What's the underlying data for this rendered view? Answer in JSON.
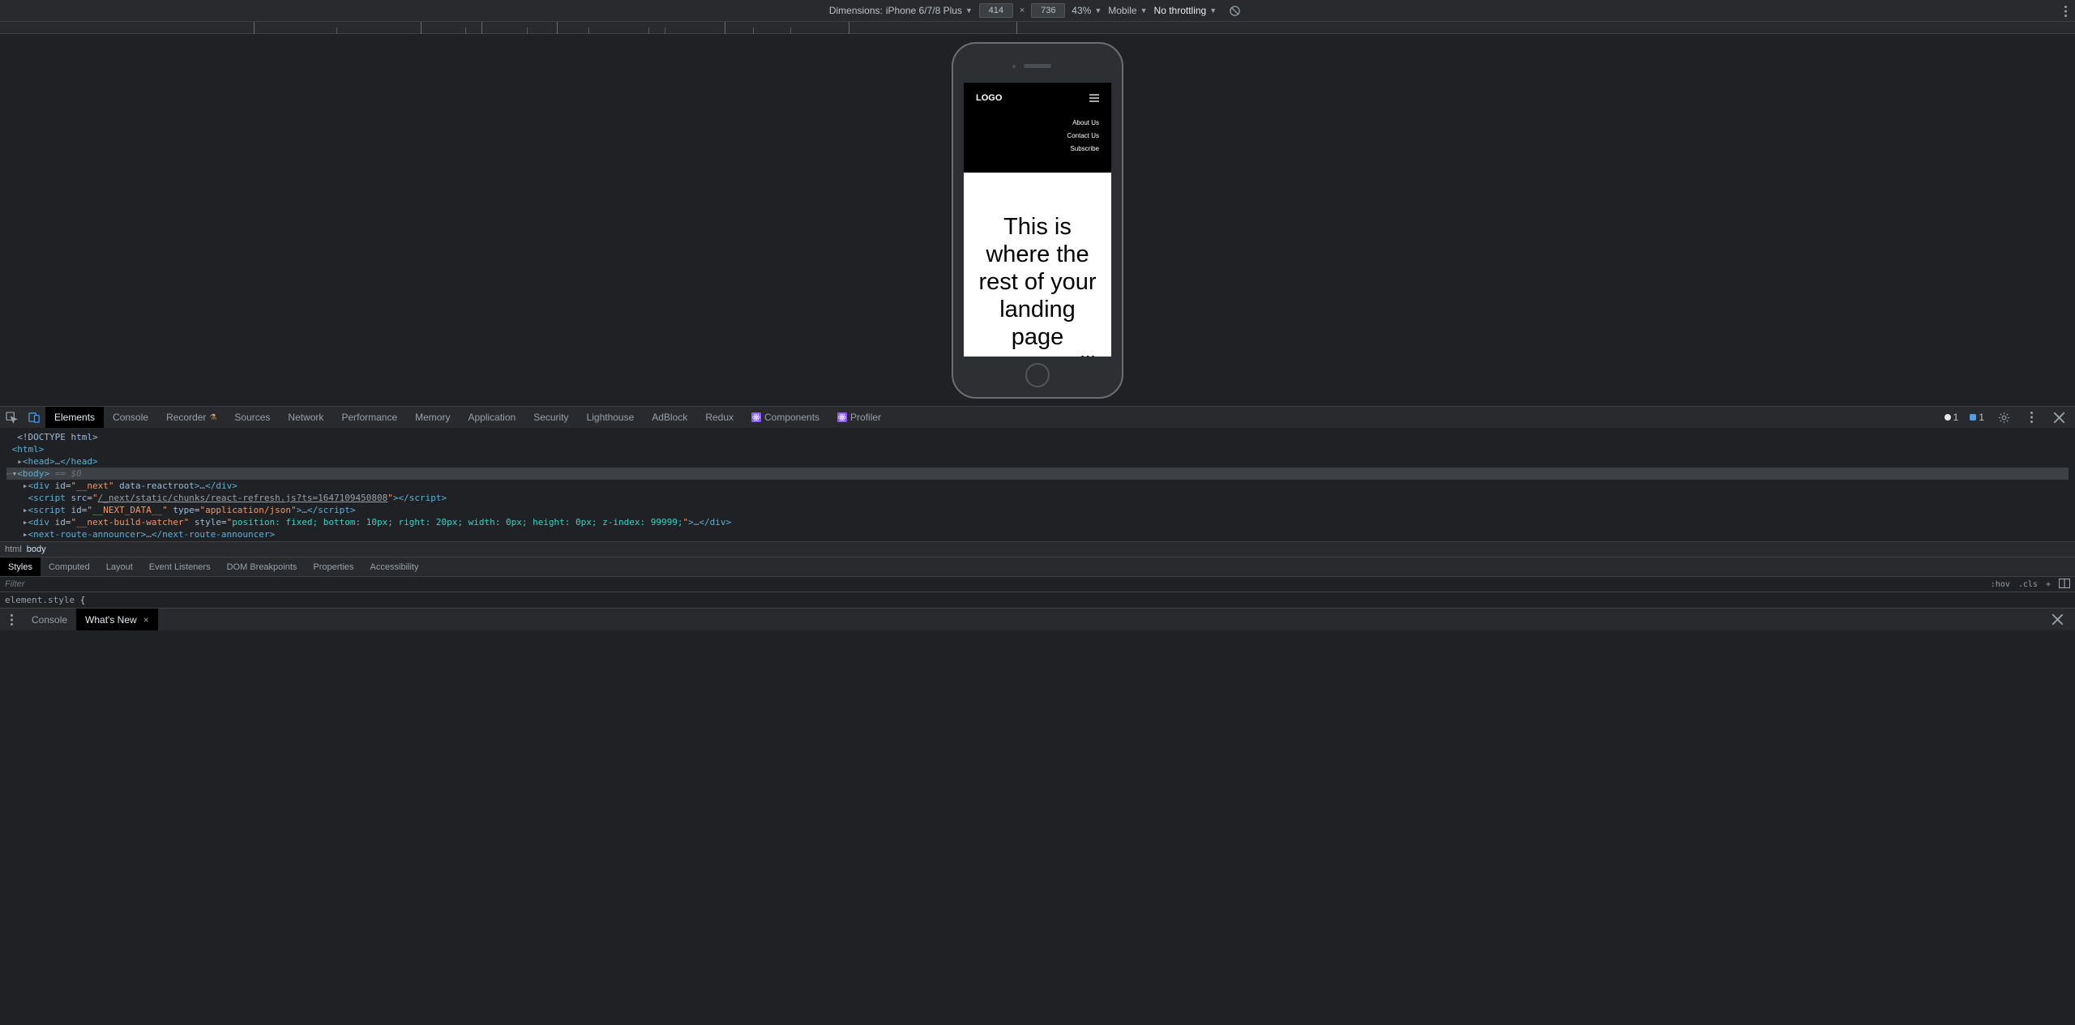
{
  "toolbar": {
    "dimensions_label": "Dimensions:",
    "device": "iPhone 6/7/8 Plus",
    "width": "414",
    "height": "736",
    "zoom": "43%",
    "device_type": "Mobile",
    "throttling": "No throttling"
  },
  "page": {
    "logo": "LOGO",
    "nav": {
      "about": "About Us",
      "contact": "Contact Us",
      "subscribe": "Subscribe"
    },
    "body_text": "This is where the rest of your landing page content will"
  },
  "tabs": {
    "elements": "Elements",
    "console": "Console",
    "recorder": "Recorder",
    "sources": "Sources",
    "network": "Network",
    "performance": "Performance",
    "memory": "Memory",
    "application": "Application",
    "security": "Security",
    "lighthouse": "Lighthouse",
    "adblock": "AdBlock",
    "redux": "Redux",
    "components": "Components",
    "profiler": "Profiler"
  },
  "errors": {
    "count": "1",
    "issues": "1"
  },
  "dom": {
    "doctype": "<!DOCTYPE html>",
    "html_open": "<html>",
    "head": "<head>…</head>",
    "body_open": "<body>",
    "eq0": " == $0",
    "div_next": "<div id=\"__next\" data-reactroot>…</div>",
    "script_src_open": "<script src=\"",
    "script_src_url": "/_next/static/chunks/react-refresh.js?ts=1647109450808",
    "script_src_close": "\"></​script>",
    "script_nextdata": "<script id=\"__NEXT_DATA__\" type=\"application/json\">…</​script>",
    "div_watcher": "<div id=\"__next-build-watcher\" style=\"position: fixed; bottom: 10px; right: 20px; width: 0px; height: 0px; z-index: 99999;\">…</div>",
    "announcer": "<next-route-announcer>…</next-route-announcer>"
  },
  "crumbs": {
    "html": "html",
    "body": "body"
  },
  "styles_tabs": {
    "styles": "Styles",
    "computed": "Computed",
    "layout": "Layout",
    "event_listeners": "Event Listeners",
    "dom_breakpoints": "DOM Breakpoints",
    "properties": "Properties",
    "accessibility": "Accessibility"
  },
  "filter": {
    "placeholder": "Filter"
  },
  "toggles": {
    "hov": ":hov",
    "cls": ".cls",
    "plus": "+"
  },
  "rule": {
    "selector": "element.style",
    "brace": "{"
  },
  "drawer": {
    "console": "Console",
    "whatsnew": "What's New"
  }
}
